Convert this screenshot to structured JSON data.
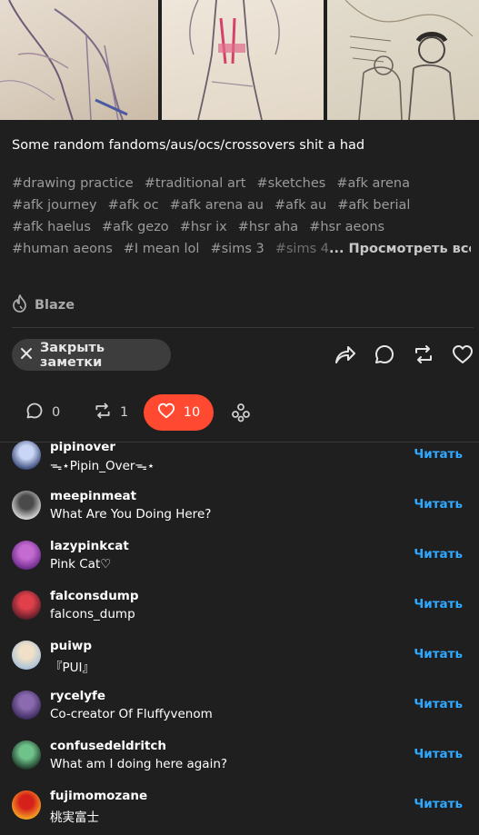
{
  "post": {
    "caption": "Some random fandoms/aus/ocs/crossovers shit a had",
    "tags": [
      [
        "#drawing practice",
        "#traditional art",
        "#sketches",
        "#afk arena"
      ],
      [
        "#afk journey",
        "#afk oc",
        "#afk arena au",
        "#afk au",
        "#afk berial"
      ],
      [
        "#afk haelus",
        "#afk gezo",
        "#hsr ix",
        "#hsr aha",
        "#hsr aeons"
      ],
      [
        "#human aeons",
        "#I mean lol",
        "#sims 3",
        "#sims 4"
      ]
    ],
    "see_all": "... Просмотреть все",
    "blaze_label": "Blaze"
  },
  "toolbar": {
    "close_notes_label": "Закрыть заметки",
    "icons": [
      "share-icon",
      "reply-icon",
      "reblog-icon",
      "heart-icon"
    ]
  },
  "counts": {
    "replies": "0",
    "reblogs": "1",
    "likes": "10"
  },
  "colors": {
    "background": "#1f1f1f",
    "likes_pill": "#ff4930",
    "follow_link": "#2fa8ff",
    "tag_text": "#9b9b9b"
  },
  "notes": [
    {
      "username": "pipinover",
      "title": "ᯓ⋆Pipin_Overᯓ⋆",
      "action": "Читать",
      "avatar_colors": [
        "#3b4b7a",
        "#c9d6f5"
      ]
    },
    {
      "username": "meepinmeat",
      "title": "What Are You Doing Here?",
      "action": "Читать",
      "avatar_colors": [
        "#d9d9d9",
        "#4a4a4a"
      ]
    },
    {
      "username": "lazypinkcat",
      "title": "Pink Cat♡",
      "action": "Читать",
      "avatar_colors": [
        "#6b2a8a",
        "#c46bd1"
      ]
    },
    {
      "username": "falconsdump",
      "title": "falcons_dump",
      "action": "Читать",
      "avatar_colors": [
        "#5a1e2a",
        "#e0404a"
      ]
    },
    {
      "username": "puiwp",
      "title": "『PUI』",
      "action": "Читать",
      "avatar_colors": [
        "#a9c2d8",
        "#f0e0c8"
      ]
    },
    {
      "username": "rycelyfe",
      "title": "Co-creator Of Fluffyvenom",
      "action": "Читать",
      "avatar_colors": [
        "#3c2a5c",
        "#8a6bb0"
      ]
    },
    {
      "username": "confusedeldritch",
      "title": "What am I doing here again?",
      "action": "Читать",
      "avatar_colors": [
        "#1e3a2a",
        "#6fc28a"
      ]
    },
    {
      "username": "fujimomozane",
      "title": "桃実富士",
      "action": "Читать",
      "avatar_colors": [
        "#f5a623",
        "#d6201a"
      ]
    }
  ]
}
